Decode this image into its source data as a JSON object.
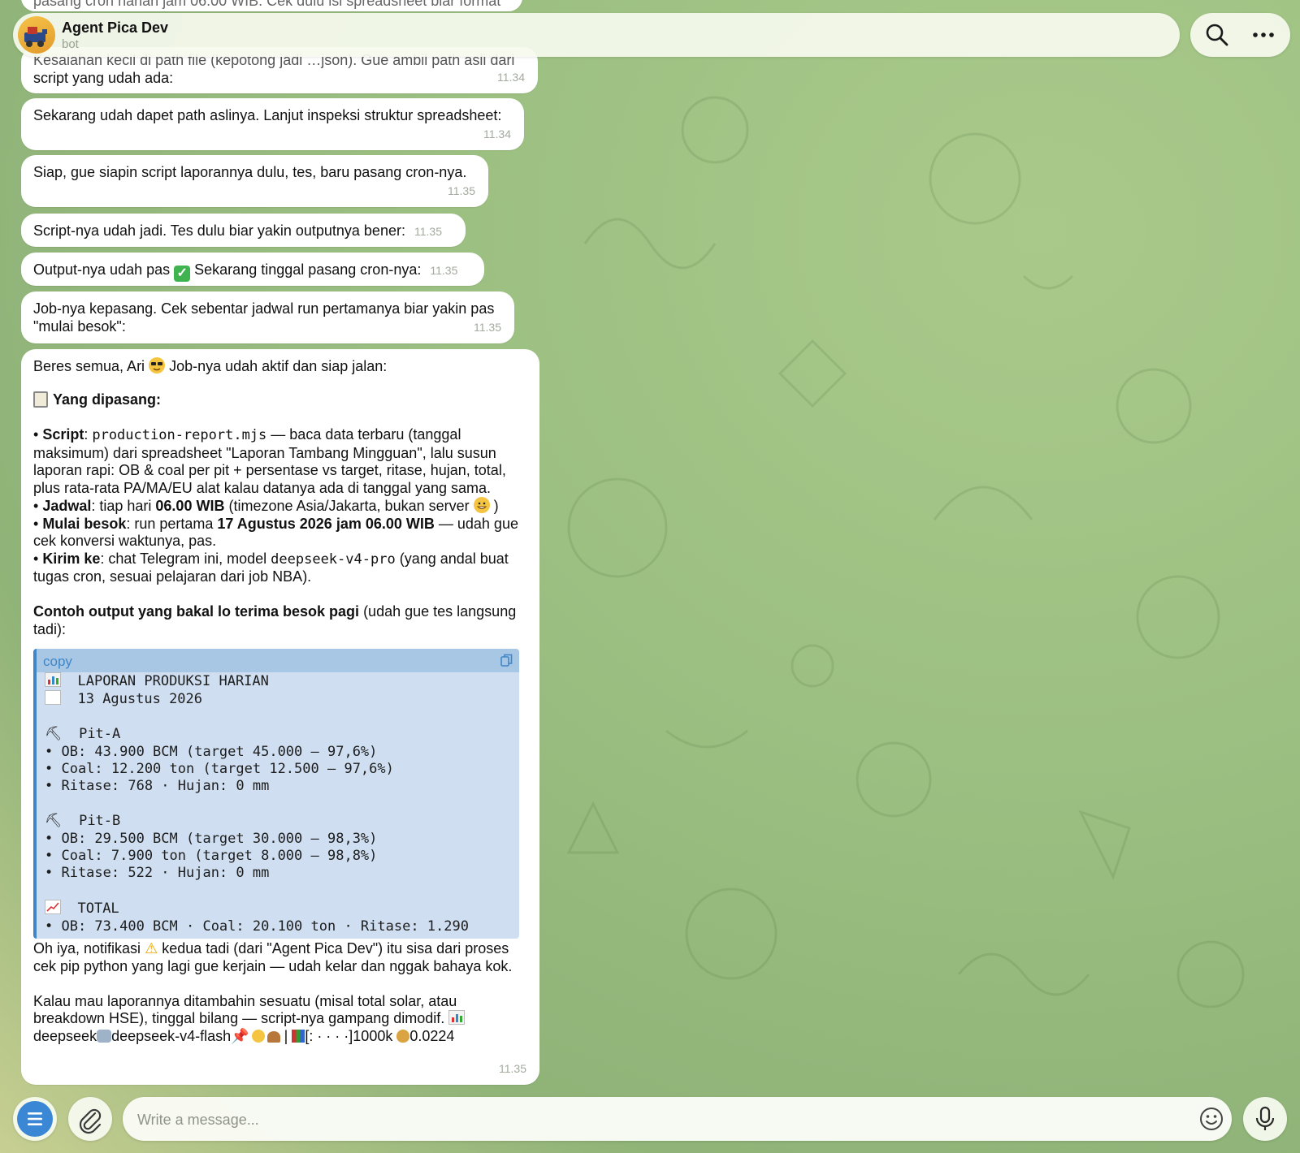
{
  "chat": {
    "title": "Agent Pica Dev",
    "subtitle": "bot",
    "header_icons": [
      "search-icon",
      "more-icon"
    ]
  },
  "messages": {
    "m0_top": "pasang cron harian jam 06.00 WIB. Cek dulu isi spreadsheet biar format",
    "m1_line1": "Kesalahan kecil di path file (kepotong jadi …json). Gue ambil path asli dari",
    "m1_line2": "script yang udah ada:",
    "m1_time": "11.34",
    "m2_text": "Sekarang udah dapet path aslinya. Lanjut inspeksi struktur spreadsheet:",
    "m2_time": "11.34",
    "m3_text": "Siap, gue siapin script laporannya dulu, tes, baru pasang cron-nya.",
    "m3_time": "11.35",
    "m4_text": "Script-nya udah jadi. Tes dulu biar yakin outputnya bener:",
    "m4_time": "11.35",
    "m5_text_a": "Output-nya udah pas",
    "m5_text_b": "Sekarang tinggal pasang cron-nya:",
    "m5_time": "11.35",
    "m6_line1": "Job-nya kepasang. Cek sebentar jadwal run pertamanya biar yakin pas",
    "m6_line2": "\"mulai besok\":",
    "m6_time": "11.35",
    "final": {
      "intro_a": "Beres semua, Ari",
      "intro_b": "Job-nya udah aktif dan siap jalan:",
      "heading": "Yang dipasang:",
      "b1_label": "Script",
      "b1_code": "production-report.mjs",
      "b1_rest1": "— baca data terbaru (tanggal",
      "b1_line2": "maksimum) dari spreadsheet \"Laporan Tambang Mingguan\", lalu susun",
      "b1_line3": "laporan rapi: OB & coal per pit + persentase vs target, ritase, hujan, total,",
      "b1_line4": "plus rata-rata PA/MA/EU alat kalau datanya ada di tanggal yang sama.",
      "b2_label": "Jadwal",
      "b2_a": ": tiap hari",
      "b2_bold": "06.00 WIB",
      "b2_b": "(timezone Asia/Jakarta, bukan server",
      "b3_label": "Mulai besok",
      "b3_a": ": run pertama",
      "b3_bold": "17 Agustus 2026 jam 06.00 WIB",
      "b3_b": "— udah gue",
      "b3_line2": "cek konversi waktunya, pas.",
      "b4_label": "Kirim ke",
      "b4_a": ": chat Telegram ini, model",
      "b4_code": "deepseek-v4-pro",
      "b4_b": "(yang andal buat",
      "b4_line2": "tugas cron, sesuai pelajaran dari job NBA).",
      "example_bold": "Contoh output yang bakal lo terima besok pagi",
      "example_rest": "(udah gue tes langsung",
      "example_line2": "tadi):",
      "code_copy_label": "copy",
      "code_lines": {
        "l1": "LAPORAN PRODUKSI HARIAN",
        "l2": "13 Agustus 2026",
        "l3": "Pit-A",
        "l4": "• OB: 43.900 BCM (target 45.000 — 97,6%)",
        "l5": "• Coal: 12.200 ton (target 12.500 — 97,6%)",
        "l6": "• Ritase: 768 · Hujan: 0 mm",
        "l7": "Pit-B",
        "l8": "• OB: 29.500 BCM (target 30.000 — 98,3%)",
        "l9": "• Coal: 7.900 ton (target 8.000 — 98,8%)",
        "l10": "• Ritase: 522 · Hujan: 0 mm",
        "l11": "TOTAL",
        "l12": "• OB: 73.400 BCM · Coal: 20.100 ton · Ritase: 1.290"
      },
      "note_a": "Oh iya, notifikasi",
      "note_b": "kedua tadi (dari \"Agent Pica Dev\") itu sisa dari proses",
      "note_line2": "cek pip python yang lagi gue kerjain — udah kelar dan nggak bahaya kok.",
      "closing_line1": "Kalau mau laporannya ditambahin sesuatu (misal total solar, atau",
      "closing_line2": "breakdown HSE), tinggal bilang — script-nya gampang dimodif.",
      "footer_a": "deepseek",
      "footer_b": "deepseek-v4-flash",
      "footer_c": "|",
      "footer_d": "[: · · · ·]1000k",
      "footer_e": "0.0224",
      "time": "11.35"
    }
  },
  "composer": {
    "placeholder": "Write a message...",
    "left_icons": [
      "menu-icon",
      "attach-icon"
    ],
    "right_icons": [
      "emoji-icon",
      "microphone-icon"
    ]
  },
  "colors": {
    "accent": "#3f86c7",
    "menu_button": "#3a87d6",
    "bubble": "#ffffff",
    "code_bg": "#cfdff1"
  }
}
